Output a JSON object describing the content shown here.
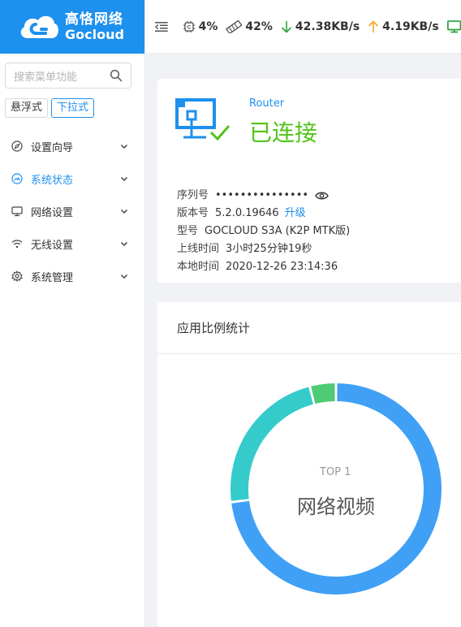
{
  "brand": {
    "name_cn": "高恪网络",
    "name_en": "Gocloud",
    "color": "#1e90ee"
  },
  "search": {
    "placeholder": "搜索菜单功能",
    "icon": "search-icon"
  },
  "mode_toggle": {
    "float_label": "悬浮式",
    "dropdown_label": "下拉式",
    "active": "dropdown"
  },
  "menu": {
    "items": [
      {
        "label": "设置向导",
        "icon": "compass-icon"
      },
      {
        "label": "系统状态",
        "icon": "dashboard-icon",
        "active": true
      },
      {
        "label": "网络设置",
        "icon": "monitor-icon"
      },
      {
        "label": "无线设置",
        "icon": "wifi-icon"
      },
      {
        "label": "系统管理",
        "icon": "gear-icon"
      }
    ]
  },
  "topbar": {
    "cpu": "4%",
    "memory": "42%",
    "download": "42.38KB/s",
    "upload": "4.19KB/s",
    "download_color": "#2aa13a",
    "upload_color": "#f5a623"
  },
  "status": {
    "device_type": "Router",
    "state": "已连接",
    "state_color": "#52c41a",
    "serial_label": "序列号",
    "serial_value": "•••••••••••••••",
    "version_label": "版本号",
    "version_value": "5.2.0.19646",
    "upgrade_link": "升级",
    "model_label": "型号",
    "model_value": "GOCLOUD S3A (K2P MTK版)",
    "uptime_label": "上线时间",
    "uptime_value": "3小时25分钟19秒",
    "localtime_label": "本地时间",
    "localtime_value": "2020-12-26 23:14:36"
  },
  "chart_title": "应用比例统计",
  "chart_data": {
    "type": "pie",
    "series": [
      {
        "value": 73,
        "color": "#3fa0f5"
      },
      {
        "value": 23,
        "color": "#36cbcb"
      },
      {
        "value": 4,
        "color": "#4ecb73"
      }
    ],
    "center_top": "TOP 1",
    "center_label": "网络视频"
  }
}
